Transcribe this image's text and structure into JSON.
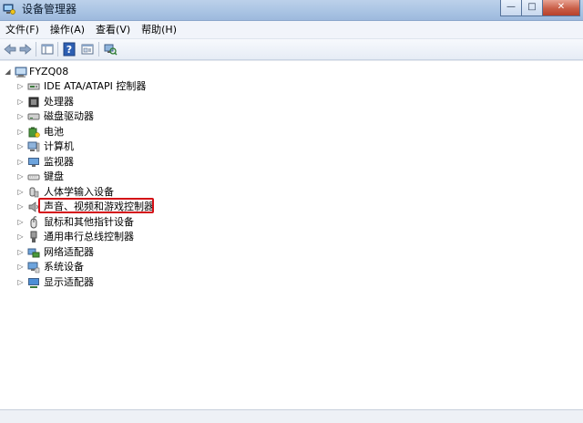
{
  "window": {
    "title": "设备管理器",
    "minimize_glyph": "—",
    "maximize_glyph": "□",
    "close_glyph": "✕"
  },
  "menu": [
    "文件(F)",
    "操作(A)",
    "查看(V)",
    "帮助(H)"
  ],
  "toolbar": {
    "icons": [
      "back-arrow-icon",
      "forward-arrow-icon",
      "show-hide-console-tree-icon",
      "help-icon",
      "properties-icon",
      "scan-hardware-changes-icon"
    ]
  },
  "tree": {
    "root": {
      "label": "FYZQ08",
      "expanded": true,
      "icon": "computer-icon"
    },
    "items": [
      {
        "label": "IDE ATA/ATAPI 控制器",
        "icon": "ide-controller-icon"
      },
      {
        "label": "处理器",
        "icon": "processor-icon"
      },
      {
        "label": "磁盘驱动器",
        "icon": "disk-drive-icon"
      },
      {
        "label": "电池",
        "icon": "battery-icon"
      },
      {
        "label": "计算机",
        "icon": "computer-icon"
      },
      {
        "label": "监视器",
        "icon": "monitor-icon"
      },
      {
        "label": "键盘",
        "icon": "keyboard-icon"
      },
      {
        "label": "人体学输入设备",
        "icon": "hid-icon"
      },
      {
        "label": "声音、视频和游戏控制器",
        "icon": "speaker-icon",
        "highlighted": true
      },
      {
        "label": "鼠标和其他指针设备",
        "icon": "mouse-icon"
      },
      {
        "label": "通用串行总线控制器",
        "icon": "usb-icon"
      },
      {
        "label": "网络适配器",
        "icon": "network-adapter-icon"
      },
      {
        "label": "系统设备",
        "icon": "system-devices-icon"
      },
      {
        "label": "显示适配器",
        "icon": "display-adapter-icon"
      }
    ]
  },
  "colors": {
    "highlight_border": "#d40f16",
    "titlebar": "#a9c3e3"
  }
}
